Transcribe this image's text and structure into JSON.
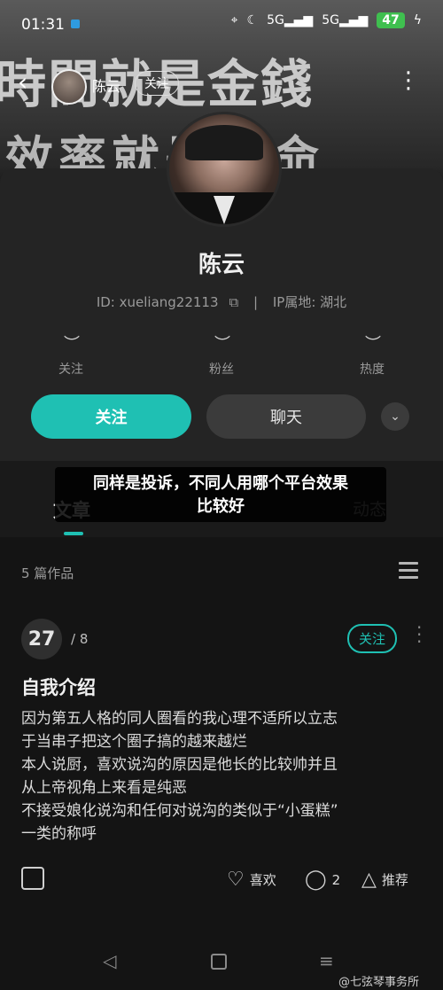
{
  "status_bar": {
    "time": "01:31",
    "signal_1": "5G",
    "signal_2": "5G",
    "battery": "47"
  },
  "banner": {
    "line1": "時間就是金錢",
    "line2": "效率就是生命"
  },
  "topbar": {
    "mini_name": "陈云",
    "mini_follow": "关注"
  },
  "profile": {
    "name": "陈云",
    "id_text": "ID: xueliang22113",
    "ip_text": "IP属地:  湖北",
    "stats": [
      {
        "label": "关注"
      },
      {
        "label": "粉丝"
      },
      {
        "label": "热度"
      }
    ],
    "follow_button": "关注",
    "chat_button": "聊天"
  },
  "tabs": {
    "article": "文章",
    "dynamic": "动态"
  },
  "overlay": {
    "line1": "同样是投诉，不同人用哪个平台效果",
    "line2": "比较好"
  },
  "works": {
    "count_label": "5 篇作品"
  },
  "post": {
    "badge_num": "27",
    "badge_total": "/ 8",
    "follow_label": "关注",
    "title": "自我介绍",
    "body_lines": [
      "因为第五人格的同人圈看的我心理不适所以立志",
      "于当串子把这个圈子搞的越来越烂",
      "本人说厨，喜欢说沟的原因是他长的比较帅并且",
      "从上帝视角上来看是纯恶",
      "不接受娘化说沟和任何对说沟的类似于“小蛋糕”",
      "一类的称呼"
    ],
    "like_label": "喜欢",
    "comment_count": "2",
    "recommend_label": "推荐"
  },
  "watermark": "@七弦琴事务所"
}
